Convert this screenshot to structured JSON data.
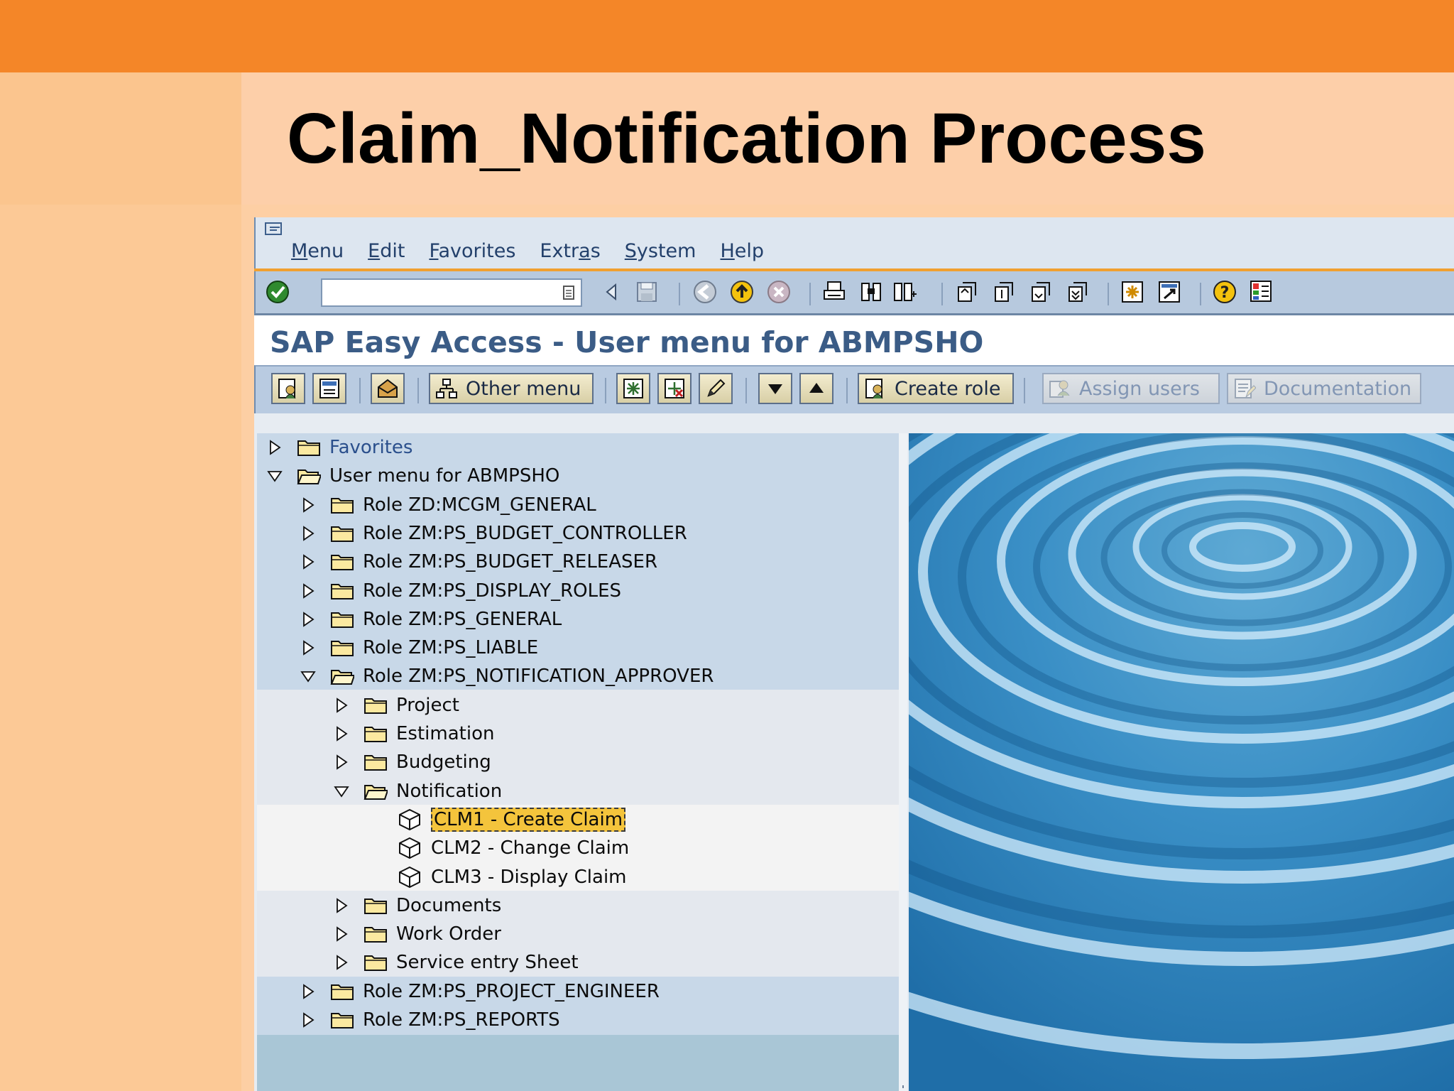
{
  "slide": {
    "title": "Claim_Notification Process"
  },
  "menu": {
    "items": [
      {
        "ul": "M",
        "rest": "enu"
      },
      {
        "ul": "E",
        "rest": "dit"
      },
      {
        "ul": "F",
        "rest": "avorites"
      },
      {
        "pre": "Extr",
        "ul": "a",
        "rest": "s"
      },
      {
        "ul": "S",
        "rest": "ystem"
      },
      {
        "ul": "H",
        "rest": "elp"
      }
    ]
  },
  "window": {
    "title": "SAP Easy Access  -  User menu for ABMPSHO"
  },
  "command_field": {
    "value": ""
  },
  "app_toolbar": {
    "other_menu": "Other menu",
    "create_role": "Create role",
    "assign_users": "Assign users",
    "documentation": "Documentation"
  },
  "tree": {
    "favorites": "Favorites",
    "user_menu": "User menu for ABMPSHO",
    "roles_top": [
      "Role ZD:MCGM_GENERAL",
      "Role ZM:PS_BUDGET_CONTROLLER",
      "Role ZM:PS_BUDGET_RELEASER",
      "Role ZM:PS_DISPLAY_ROLES",
      "Role ZM:PS_GENERAL",
      "Role ZM:PS_LIABLE"
    ],
    "open_role": "Role ZM:PS_NOTIFICATION_APPROVER",
    "open_role_children_top": [
      "Project",
      "Estimation",
      "Budgeting"
    ],
    "notification": "Notification",
    "transactions": [
      "CLM1 - Create Claim",
      "CLM2 - Change Claim",
      "CLM3 - Display Claim"
    ],
    "open_role_children_bottom": [
      "Documents",
      "Work Order",
      "Service entry Sheet"
    ],
    "roles_bottom": [
      "Role ZM:PS_PROJECT_ENGINEER",
      "Role ZM:PS_REPORTS"
    ]
  },
  "colors": {
    "accent_orange": "#f48628",
    "sap_title_blue": "#3b5c86",
    "selection": "#f4c43c"
  }
}
